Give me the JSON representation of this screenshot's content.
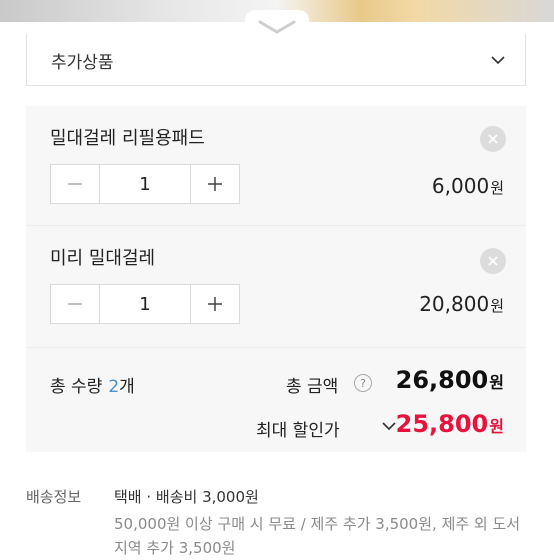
{
  "select": {
    "label": "추가상품"
  },
  "options": [
    {
      "name": "밀대걸레 리필용패드",
      "quantity": "1",
      "price": "6,000",
      "currency": "원"
    },
    {
      "name": "미리 밀대걸레",
      "quantity": "1",
      "price": "20,800",
      "currency": "원"
    }
  ],
  "stepper": {
    "minus": "−",
    "plus": "+"
  },
  "summary": {
    "qty_label": "총 수량",
    "qty_value": "2",
    "qty_suffix": "개",
    "total_label": "총 금액",
    "help": "?",
    "total_amount": "26,800",
    "currency": "원",
    "discount_label": "최대 할인가",
    "discount_amount": "25,800"
  },
  "shipping": {
    "label": "배송정보",
    "value": "택배 · 배송비 3,000원",
    "detail": "50,000원 이상 구매 시 무료 / 제주 추가 3,500원, 제주 외 도서지역 추가 3,500원"
  },
  "colors": {
    "accent_red": "#e8123c",
    "accent_blue": "#4a90c9"
  }
}
